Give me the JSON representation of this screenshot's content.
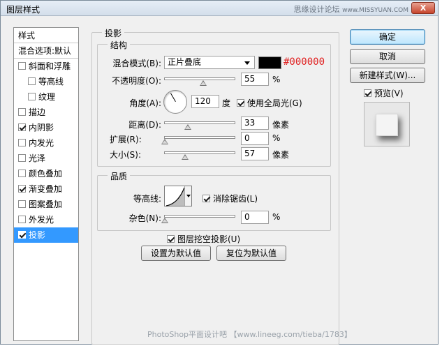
{
  "window": {
    "title": "图层样式",
    "watermark_top": "思缘设计论坛",
    "watermark_top_url": "www.MISSYUAN.COM",
    "close_label": "X"
  },
  "style_list": {
    "header": "样式",
    "blend_options": "混合选项:默认",
    "items": [
      {
        "label": "斜面和浮雕",
        "checked": false
      },
      {
        "label": "等高线",
        "checked": false
      },
      {
        "label": "纹理",
        "checked": false
      },
      {
        "label": "描边",
        "checked": false
      },
      {
        "label": "内阴影",
        "checked": true
      },
      {
        "label": "内发光",
        "checked": false
      },
      {
        "label": "光泽",
        "checked": false
      },
      {
        "label": "颜色叠加",
        "checked": false
      },
      {
        "label": "渐变叠加",
        "checked": true
      },
      {
        "label": "图案叠加",
        "checked": false
      },
      {
        "label": "外发光",
        "checked": false
      },
      {
        "label": "投影",
        "checked": true
      }
    ]
  },
  "drop_shadow": {
    "section_title": "投影",
    "structure_title": "结构",
    "blend_mode_label": "混合模式(B):",
    "blend_mode_value": "正片叠底",
    "color_hex": "#000000",
    "opacity_label": "不透明度(O):",
    "opacity_value": "55",
    "opacity_unit": "%",
    "angle_label": "角度(A):",
    "angle_value": "120",
    "angle_unit": "度",
    "global_light_label": "使用全局光(G)",
    "global_light_checked": true,
    "distance_label": "距离(D):",
    "distance_value": "33",
    "distance_unit": "像素",
    "spread_label": "扩展(R):",
    "spread_value": "0",
    "spread_unit": "%",
    "size_label": "大小(S):",
    "size_value": "57",
    "size_unit": "像素",
    "quality_title": "品质",
    "contour_label": "等高线:",
    "anti_alias_label": "消除锯齿(L)",
    "anti_alias_checked": true,
    "noise_label": "杂色(N):",
    "noise_value": "0",
    "noise_unit": "%",
    "knockout_label": "图层挖空投影(U)",
    "knockout_checked": true,
    "set_default_label": "设置为默认值",
    "reset_default_label": "复位为默认值"
  },
  "buttons": {
    "ok": "确定",
    "cancel": "取消",
    "new_style": "新建样式(W)...",
    "preview_label": "预览(V)",
    "preview_checked": true
  },
  "footer_watermark": "PhotoShop平面设计吧 【www.lineeg.com/tieba/1783】",
  "colors": {
    "selection": "#3399ff",
    "hex_text": "#e02020",
    "shadow_color": "#000000"
  }
}
